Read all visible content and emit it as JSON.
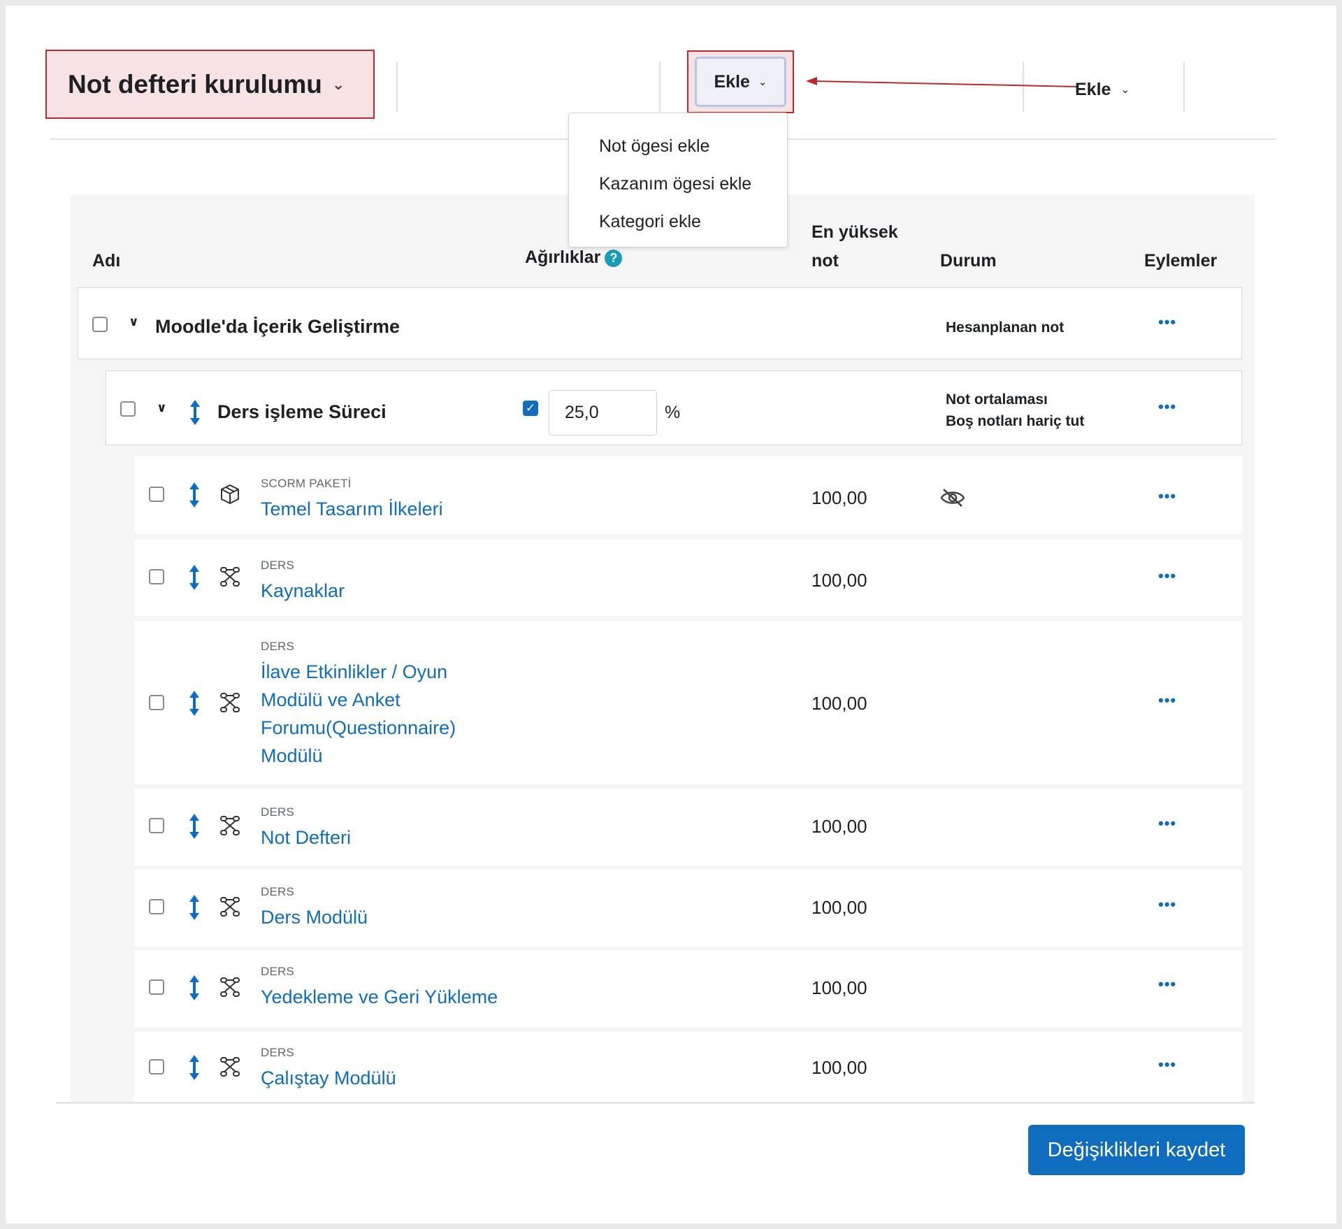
{
  "header": {
    "title": "Not defteri kurulumu",
    "add_button_label": "Ekle",
    "add_label_right": "Ekle"
  },
  "dropdown": {
    "items": [
      "Not ögesi ekle",
      "Kazanım ögesi ekle",
      "Kategori ekle"
    ]
  },
  "table": {
    "headers": {
      "name": "Adı",
      "weights": "Ağırlıklar",
      "max_grade_line1": "En yüksek",
      "max_grade_line2": "not",
      "status": "Durum",
      "actions": "Eylemler"
    },
    "course_category": {
      "name": "Moodle'da İçerik Geliştirme",
      "status": "Hesanplanan not"
    },
    "sub_category": {
      "name": "Ders işleme Süreci",
      "weight_value": "25,0",
      "weight_unit": "%",
      "status_line1": "Not ortalaması",
      "status_line2": "Boş notları hariç tut"
    },
    "items": [
      {
        "type": "SCORM PAKETİ",
        "name": "Temel Tasarım İlkeleri",
        "max": "100,00",
        "hidden": true
      },
      {
        "type": "DERS",
        "name": "Kaynaklar",
        "max": "100,00"
      },
      {
        "type": "DERS",
        "name_lines": [
          "İlave Etkinlikler / Oyun",
          "Modülü ve Anket",
          "Forumu(Questionnaire)",
          "Modülü"
        ],
        "max": "100,00"
      },
      {
        "type": "DERS",
        "name": "Not Defteri",
        "max": "100,00"
      },
      {
        "type": "DERS",
        "name": "Ders Modülü",
        "max": "100,00"
      },
      {
        "type": "DERS",
        "name": "Yedekleme ve Geri Yükleme",
        "max": "100,00"
      },
      {
        "type": "DERS",
        "name": "Çalıştay Modülü",
        "max": "100,00"
      }
    ],
    "actions_label": "..."
  },
  "footer": {
    "save_label": "Değişiklikleri kaydet"
  },
  "colors": {
    "link": "#0f6cbf",
    "highlight_border": "#c0272d",
    "highlight_fill": "#f7e3e3",
    "help_icon": "#1c9bb5"
  }
}
